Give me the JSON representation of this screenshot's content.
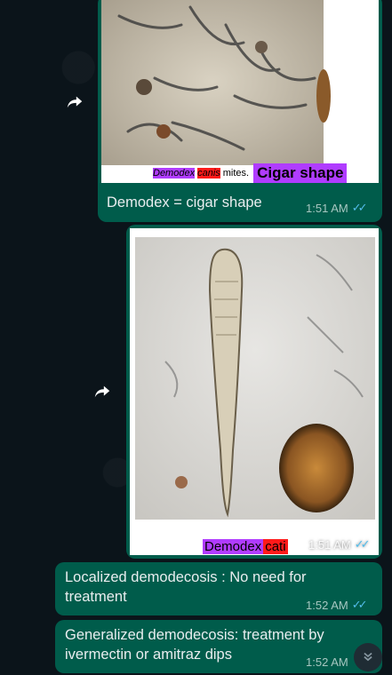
{
  "messages": [
    {
      "caption": "Demodex = cigar shape",
      "time": "1:51 AM",
      "image_label_species_part1": "Demodex",
      "image_label_species_part2": "canis",
      "image_label_suffix": "mites.",
      "image_label_tag": "Cigar shape"
    },
    {
      "time": "1:51 AM",
      "image_label_part1": "Demodex",
      "image_label_part2": "cati"
    },
    {
      "text": "Localized demodecosis : No need for treatment",
      "time": "1:52 AM"
    },
    {
      "text": "Generalized demodecosis: treatment by ivermectin or amitraz dips",
      "time": "1:52 AM"
    }
  ],
  "colors": {
    "chat_bg": "#0b141a",
    "outgoing_bubble": "#005c4b",
    "read_ticks": "#53bdeb"
  },
  "icons": {
    "forward": "forward-icon",
    "read_receipt": "double-check-icon",
    "scroll_down": "chevron-double-down-icon"
  }
}
